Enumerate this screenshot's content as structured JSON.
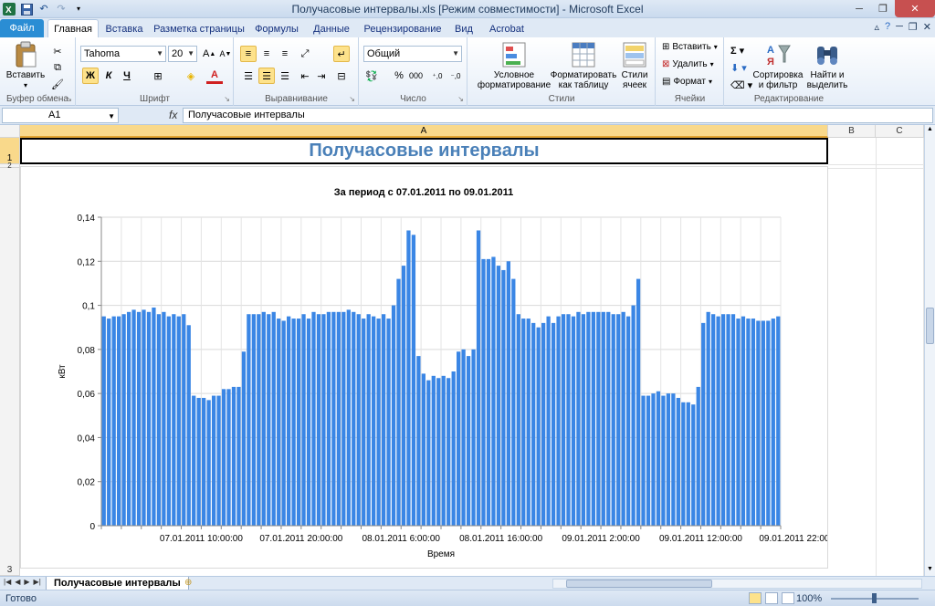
{
  "window": {
    "title": "Получасовые интервалы.xls  [Режим совместимости]  -  Microsoft Excel"
  },
  "tabs": {
    "file": "Файл",
    "items": [
      "Главная",
      "Вставка",
      "Разметка страницы",
      "Формулы",
      "Данные",
      "Рецензирование",
      "Вид",
      "Acrobat"
    ]
  },
  "ribbon": {
    "clipboard": {
      "paste": "Вставить",
      "label": "Буфер обмена"
    },
    "font": {
      "name": "Tahoma",
      "size": "20",
      "bold": "Ж",
      "italic": "К",
      "underline": "Ч",
      "label": "Шрифт"
    },
    "alignment": {
      "label": "Выравнивание"
    },
    "number": {
      "format": "Общий",
      "percent": "%",
      "thousands": "000",
      "label": "Число"
    },
    "styles": {
      "conditional": "Условное форматирование",
      "table": "Форматировать как таблицу",
      "cell": "Стили ячеек",
      "label": "Стили"
    },
    "cells": {
      "insert": "Вставить",
      "delete": "Удалить",
      "format": "Формат",
      "label": "Ячейки"
    },
    "editing": {
      "sort": "Сортировка и фильтр",
      "find": "Найти и выделить",
      "label": "Редактирование"
    }
  },
  "formula_bar": {
    "name_box": "A1",
    "fx": "fx",
    "content": "Получасовые интервалы"
  },
  "grid": {
    "columns": [
      "A",
      "B",
      "C"
    ],
    "rows": [
      "1",
      "2",
      "3"
    ],
    "a1": "Получасовые интервалы"
  },
  "sheet": {
    "tab": "Получасовые интервалы"
  },
  "status": {
    "text": "Готово",
    "zoom": "100%"
  },
  "colors": {
    "bar": "#3a86e5",
    "title": "#4a80b8"
  },
  "chart_data": {
    "type": "bar",
    "title": "За период с 07.01.2011 по 09.01.2011",
    "xlabel": "Время",
    "ylabel": "кВт",
    "ylim": [
      0,
      0.14
    ],
    "yticks": [
      "0",
      "0,02",
      "0,04",
      "0,06",
      "0,08",
      "0,1",
      "0,12",
      "0,14"
    ],
    "xtick_labels": [
      "07.01.2011 10:00:00",
      "07.01.2011 20:00:00",
      "08.01.2011 6:00:00",
      "08.01.2011 16:00:00",
      "09.01.2011 2:00:00",
      "09.01.2011 12:00:00",
      "09.01.2011 22:00:00"
    ],
    "grid": true,
    "values": [
      0.095,
      0.094,
      0.095,
      0.095,
      0.096,
      0.097,
      0.098,
      0.097,
      0.098,
      0.097,
      0.099,
      0.096,
      0.097,
      0.095,
      0.096,
      0.095,
      0.096,
      0.091,
      0.059,
      0.058,
      0.058,
      0.057,
      0.059,
      0.059,
      0.062,
      0.062,
      0.063,
      0.063,
      0.079,
      0.096,
      0.096,
      0.096,
      0.097,
      0.096,
      0.097,
      0.094,
      0.093,
      0.095,
      0.094,
      0.094,
      0.096,
      0.094,
      0.097,
      0.096,
      0.096,
      0.097,
      0.097,
      0.097,
      0.097,
      0.098,
      0.097,
      0.096,
      0.094,
      0.096,
      0.095,
      0.094,
      0.096,
      0.094,
      0.1,
      0.112,
      0.118,
      0.134,
      0.132,
      0.077,
      0.069,
      0.066,
      0.068,
      0.067,
      0.068,
      0.067,
      0.07,
      0.079,
      0.08,
      0.077,
      0.08,
      0.134,
      0.121,
      0.121,
      0.122,
      0.118,
      0.116,
      0.12,
      0.112,
      0.096,
      0.094,
      0.094,
      0.092,
      0.09,
      0.092,
      0.095,
      0.092,
      0.095,
      0.096,
      0.096,
      0.095,
      0.097,
      0.096,
      0.097,
      0.097,
      0.097,
      0.097,
      0.097,
      0.096,
      0.096,
      0.097,
      0.095,
      0.1,
      0.112,
      0.059,
      0.059,
      0.06,
      0.061,
      0.059,
      0.06,
      0.06,
      0.058,
      0.056,
      0.056,
      0.055,
      0.063,
      0.092,
      0.097,
      0.096,
      0.095,
      0.096,
      0.096,
      0.096,
      0.094,
      0.095,
      0.094,
      0.094,
      0.093,
      0.093,
      0.093,
      0.094,
      0.095
    ]
  }
}
